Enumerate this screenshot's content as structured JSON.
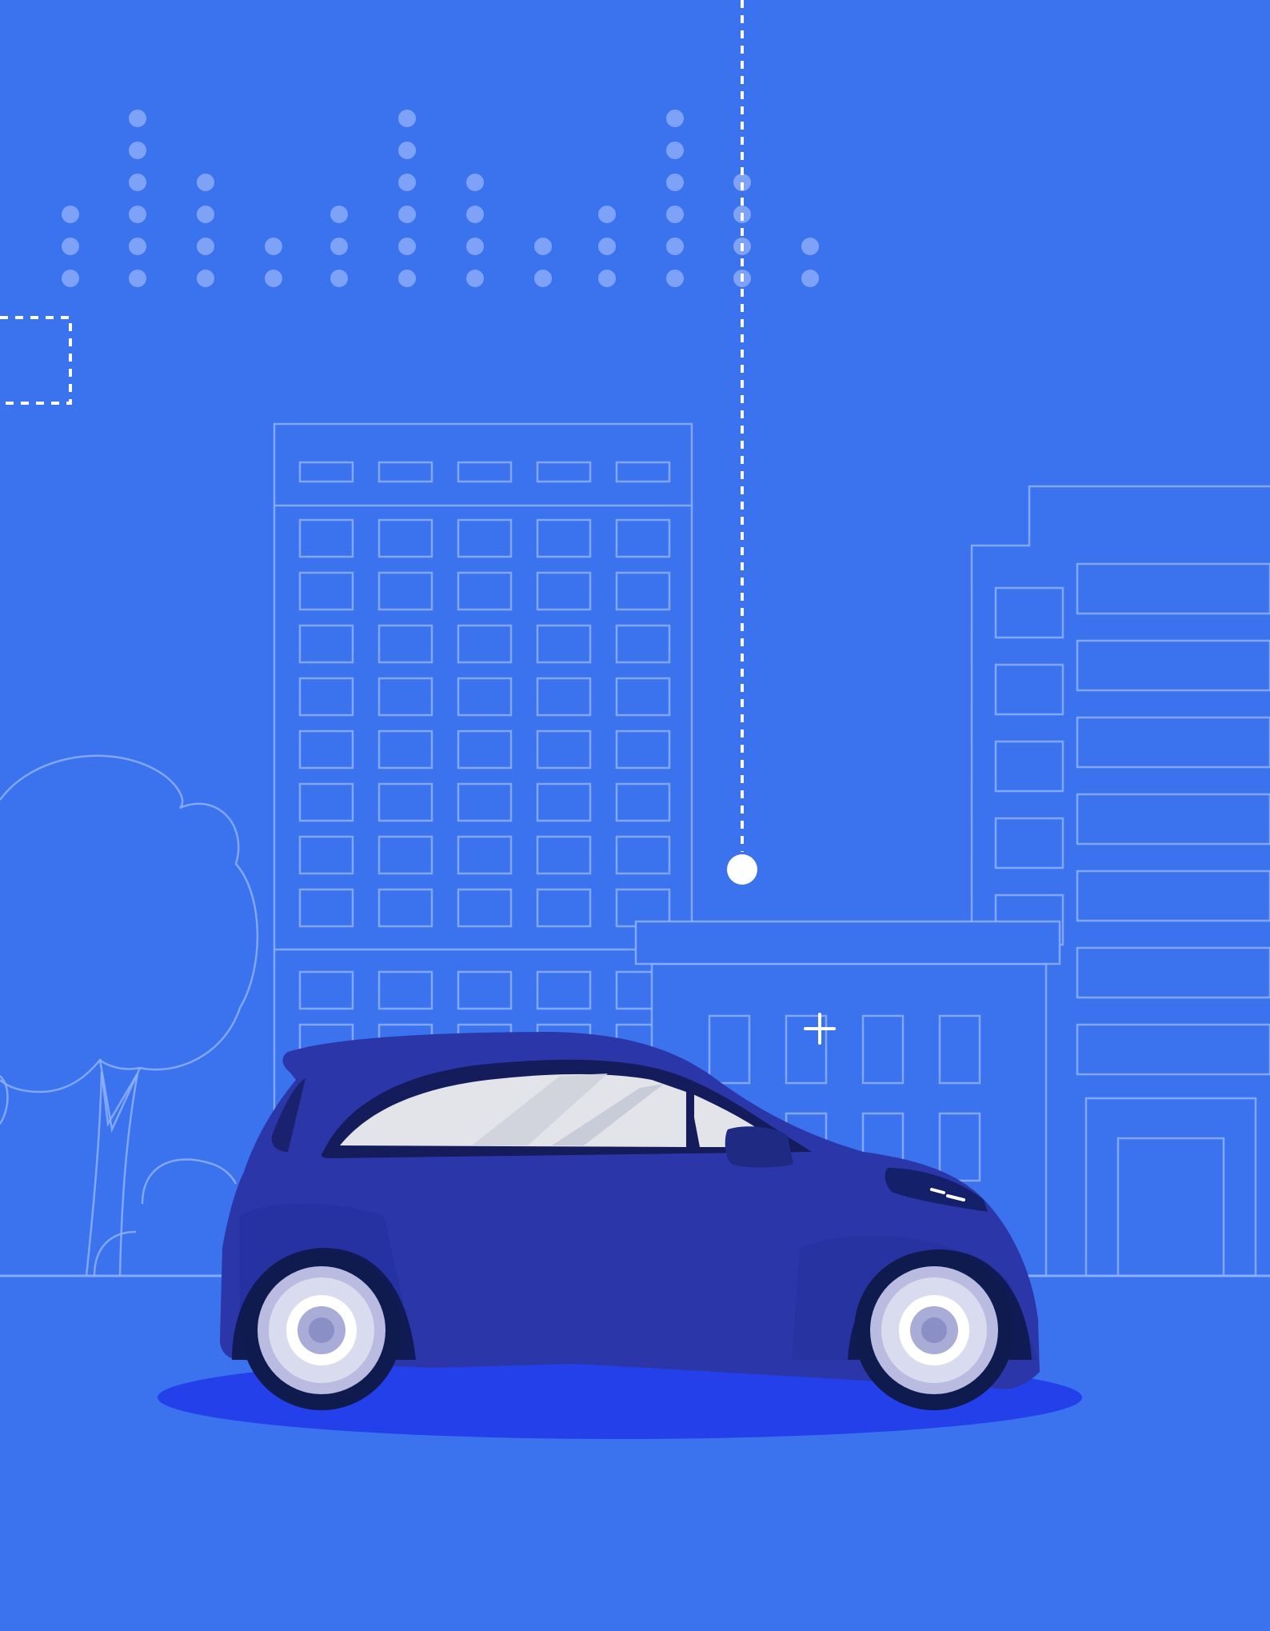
{
  "scene": {
    "background_color": "#3b72ee",
    "outline_color": "#8fb0fb",
    "dot_color": "#7ea2f8",
    "car_body_color": "#2b37a8",
    "car_shadow_color": "#2340ea",
    "window_color": "#e2e4ea",
    "wheel_color": "#b9bce0",
    "icons": [
      "dot-matrix-bars",
      "dashed-frame",
      "dashed-pin-line",
      "tree-icon",
      "hospital-building",
      "plus-cross-icon",
      "compact-car"
    ]
  }
}
